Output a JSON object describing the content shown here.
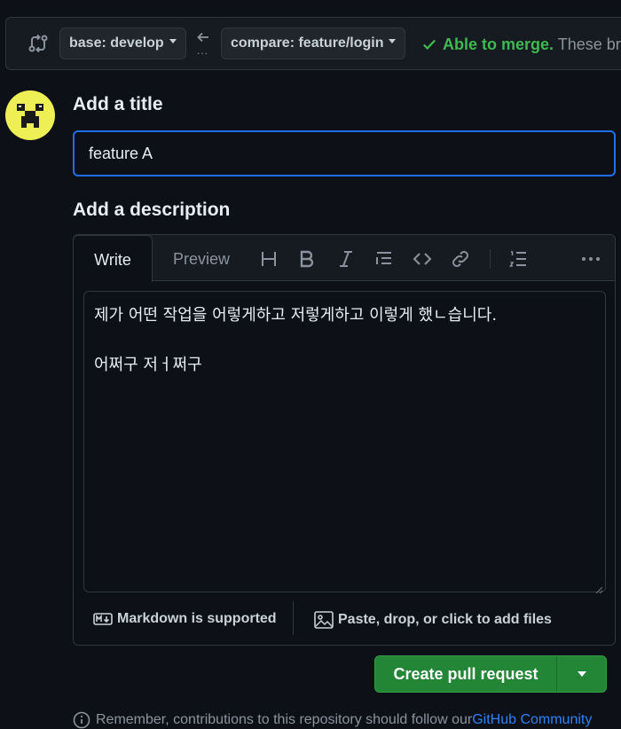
{
  "compare_bar": {
    "base_label": "base: develop",
    "compare_label": "compare: feature/login",
    "ellipsis": "...",
    "merge_status_bold": "Able to merge.",
    "merge_status_rest": " These br"
  },
  "form": {
    "title_heading": "Add a title",
    "title_value": "feature A",
    "description_heading": "Add a description"
  },
  "editor": {
    "tab_write": "Write",
    "tab_preview": "Preview",
    "body_lines": [
      "제가 어떤 작업을 어렇게하고 저렇게하고 이렇게 했ㄴ습니다.",
      "",
      "어쩌구 저ㅓ쩌구"
    ],
    "markdown_note": "Markdown is supported",
    "attach_note": "Paste, drop, or click to add files"
  },
  "actions": {
    "create_label": "Create pull request"
  },
  "footer": {
    "remember_text": "Remember, contributions to this repository should follow our ",
    "remember_link": "GitHub Community"
  },
  "colors": {
    "background": "#0d1117",
    "accent_blue": "#1f6feb",
    "merge_green": "#3fb950",
    "button_green": "#238636"
  }
}
